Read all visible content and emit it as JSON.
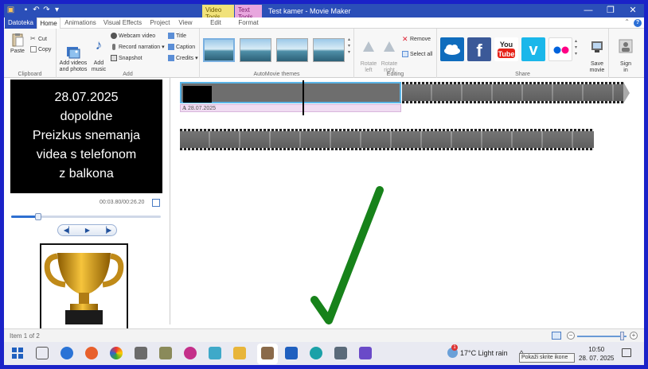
{
  "window": {
    "title": "Test kamer - Movie Maker",
    "context_tab_video": "Video Tools",
    "context_tab_text": "Text Tools",
    "minimize": "—",
    "maximize": "❐",
    "close": "✕"
  },
  "quick_access": [
    "save-icon",
    "undo-icon",
    "redo-icon",
    "dropdown-icon"
  ],
  "tabs": [
    {
      "label": "Datoteka"
    },
    {
      "label": "Home"
    },
    {
      "label": "Animations"
    },
    {
      "label": "Visual Effects"
    },
    {
      "label": "Project"
    },
    {
      "label": "View"
    },
    {
      "label": "Edit"
    },
    {
      "label": "Format"
    }
  ],
  "help": "?",
  "ribbon": {
    "clipboard": {
      "label": "Clipboard",
      "paste": "Paste",
      "cut": "Cut",
      "copy": "Copy"
    },
    "add": {
      "label": "Add",
      "add_videos": "Add videos\nand photos",
      "add_music": "Add\nmusic",
      "webcam": "Webcam video",
      "narration": "Record narration",
      "snapshot": "Snapshot",
      "title": "Title",
      "caption": "Caption",
      "credits": "Credits"
    },
    "themes": {
      "label": "AutoMovie themes"
    },
    "editing": {
      "label": "Editing",
      "rotate_left": "Rotate\nleft",
      "rotate_right": "Rotate\nright",
      "remove": "Remove",
      "select_all": "Select all"
    },
    "share": {
      "label": "Share",
      "save_movie": "Save\nmovie",
      "sign_in": "Sign\nin",
      "colors": {
        "onedrive": "#0f6cbd",
        "facebook": "#3b5998",
        "youtube": "#e62117",
        "vimeo": "#1ab7ea",
        "flickr": "#ffffff"
      }
    }
  },
  "preview": {
    "lines": [
      "28.07.2025",
      "dopoldne",
      "Preizkus snemanja",
      "videa s telefonom",
      "z balkona"
    ],
    "timecode": "00:03.80/00:26.20",
    "seek_fraction": 0.18,
    "prev": "◀▏",
    "play": "▶",
    "next": "▕▶"
  },
  "timeline": {
    "caption_label": "28.07.2025",
    "caption_icon": "A"
  },
  "status": {
    "items": "Item 1 of 2",
    "zoom_minus": "−",
    "zoom_plus": "+"
  },
  "taskbar": {
    "weather": "17°C  Light rain",
    "weather_badge": "1",
    "tooltip": "Pokaži skrite ikone",
    "time": "10:50",
    "date": "28. 07. 2025"
  }
}
